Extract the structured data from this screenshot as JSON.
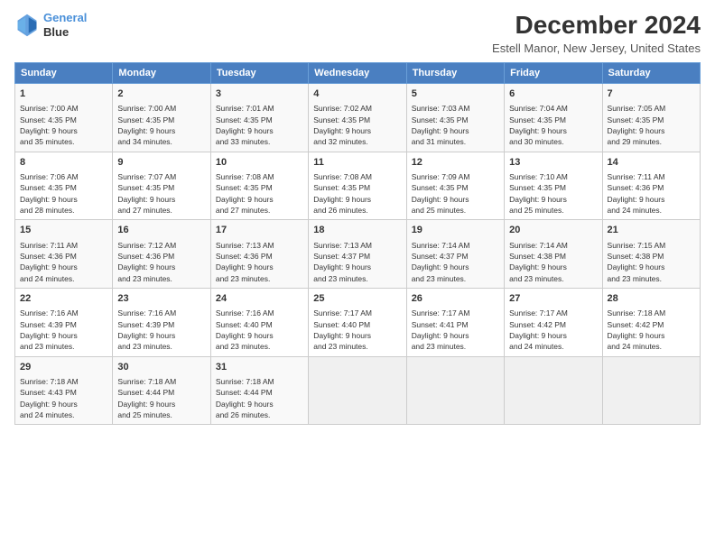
{
  "header": {
    "logo_line1": "General",
    "logo_line2": "Blue",
    "main_title": "December 2024",
    "subtitle": "Estell Manor, New Jersey, United States"
  },
  "calendar": {
    "days_of_week": [
      "Sunday",
      "Monday",
      "Tuesday",
      "Wednesday",
      "Thursday",
      "Friday",
      "Saturday"
    ],
    "weeks": [
      [
        {
          "day": "",
          "info": "",
          "empty": true
        },
        {
          "day": "",
          "info": "",
          "empty": true
        },
        {
          "day": "",
          "info": "",
          "empty": true
        },
        {
          "day": "",
          "info": "",
          "empty": true
        },
        {
          "day": "",
          "info": "",
          "empty": true
        },
        {
          "day": "",
          "info": "",
          "empty": true
        },
        {
          "day": "",
          "info": "",
          "empty": true
        }
      ],
      [
        {
          "day": "1",
          "info": "Sunrise: 7:00 AM\nSunset: 4:35 PM\nDaylight: 9 hours\nand 35 minutes."
        },
        {
          "day": "2",
          "info": "Sunrise: 7:00 AM\nSunset: 4:35 PM\nDaylight: 9 hours\nand 34 minutes."
        },
        {
          "day": "3",
          "info": "Sunrise: 7:01 AM\nSunset: 4:35 PM\nDaylight: 9 hours\nand 33 minutes."
        },
        {
          "day": "4",
          "info": "Sunrise: 7:02 AM\nSunset: 4:35 PM\nDaylight: 9 hours\nand 32 minutes."
        },
        {
          "day": "5",
          "info": "Sunrise: 7:03 AM\nSunset: 4:35 PM\nDaylight: 9 hours\nand 31 minutes."
        },
        {
          "day": "6",
          "info": "Sunrise: 7:04 AM\nSunset: 4:35 PM\nDaylight: 9 hours\nand 30 minutes."
        },
        {
          "day": "7",
          "info": "Sunrise: 7:05 AM\nSunset: 4:35 PM\nDaylight: 9 hours\nand 29 minutes."
        }
      ],
      [
        {
          "day": "8",
          "info": "Sunrise: 7:06 AM\nSunset: 4:35 PM\nDaylight: 9 hours\nand 28 minutes."
        },
        {
          "day": "9",
          "info": "Sunrise: 7:07 AM\nSunset: 4:35 PM\nDaylight: 9 hours\nand 27 minutes."
        },
        {
          "day": "10",
          "info": "Sunrise: 7:08 AM\nSunset: 4:35 PM\nDaylight: 9 hours\nand 27 minutes."
        },
        {
          "day": "11",
          "info": "Sunrise: 7:08 AM\nSunset: 4:35 PM\nDaylight: 9 hours\nand 26 minutes."
        },
        {
          "day": "12",
          "info": "Sunrise: 7:09 AM\nSunset: 4:35 PM\nDaylight: 9 hours\nand 25 minutes."
        },
        {
          "day": "13",
          "info": "Sunrise: 7:10 AM\nSunset: 4:35 PM\nDaylight: 9 hours\nand 25 minutes."
        },
        {
          "day": "14",
          "info": "Sunrise: 7:11 AM\nSunset: 4:36 PM\nDaylight: 9 hours\nand 24 minutes."
        }
      ],
      [
        {
          "day": "15",
          "info": "Sunrise: 7:11 AM\nSunset: 4:36 PM\nDaylight: 9 hours\nand 24 minutes."
        },
        {
          "day": "16",
          "info": "Sunrise: 7:12 AM\nSunset: 4:36 PM\nDaylight: 9 hours\nand 23 minutes."
        },
        {
          "day": "17",
          "info": "Sunrise: 7:13 AM\nSunset: 4:36 PM\nDaylight: 9 hours\nand 23 minutes."
        },
        {
          "day": "18",
          "info": "Sunrise: 7:13 AM\nSunset: 4:37 PM\nDaylight: 9 hours\nand 23 minutes."
        },
        {
          "day": "19",
          "info": "Sunrise: 7:14 AM\nSunset: 4:37 PM\nDaylight: 9 hours\nand 23 minutes."
        },
        {
          "day": "20",
          "info": "Sunrise: 7:14 AM\nSunset: 4:38 PM\nDaylight: 9 hours\nand 23 minutes."
        },
        {
          "day": "21",
          "info": "Sunrise: 7:15 AM\nSunset: 4:38 PM\nDaylight: 9 hours\nand 23 minutes."
        }
      ],
      [
        {
          "day": "22",
          "info": "Sunrise: 7:16 AM\nSunset: 4:39 PM\nDaylight: 9 hours\nand 23 minutes."
        },
        {
          "day": "23",
          "info": "Sunrise: 7:16 AM\nSunset: 4:39 PM\nDaylight: 9 hours\nand 23 minutes."
        },
        {
          "day": "24",
          "info": "Sunrise: 7:16 AM\nSunset: 4:40 PM\nDaylight: 9 hours\nand 23 minutes."
        },
        {
          "day": "25",
          "info": "Sunrise: 7:17 AM\nSunset: 4:40 PM\nDaylight: 9 hours\nand 23 minutes."
        },
        {
          "day": "26",
          "info": "Sunrise: 7:17 AM\nSunset: 4:41 PM\nDaylight: 9 hours\nand 23 minutes."
        },
        {
          "day": "27",
          "info": "Sunrise: 7:17 AM\nSunset: 4:42 PM\nDaylight: 9 hours\nand 24 minutes."
        },
        {
          "day": "28",
          "info": "Sunrise: 7:18 AM\nSunset: 4:42 PM\nDaylight: 9 hours\nand 24 minutes."
        }
      ],
      [
        {
          "day": "29",
          "info": "Sunrise: 7:18 AM\nSunset: 4:43 PM\nDaylight: 9 hours\nand 24 minutes."
        },
        {
          "day": "30",
          "info": "Sunrise: 7:18 AM\nSunset: 4:44 PM\nDaylight: 9 hours\nand 25 minutes."
        },
        {
          "day": "31",
          "info": "Sunrise: 7:18 AM\nSunset: 4:44 PM\nDaylight: 9 hours\nand 26 minutes."
        },
        {
          "day": "",
          "info": "",
          "empty": true
        },
        {
          "day": "",
          "info": "",
          "empty": true
        },
        {
          "day": "",
          "info": "",
          "empty": true
        },
        {
          "day": "",
          "info": "",
          "empty": true
        }
      ]
    ]
  }
}
